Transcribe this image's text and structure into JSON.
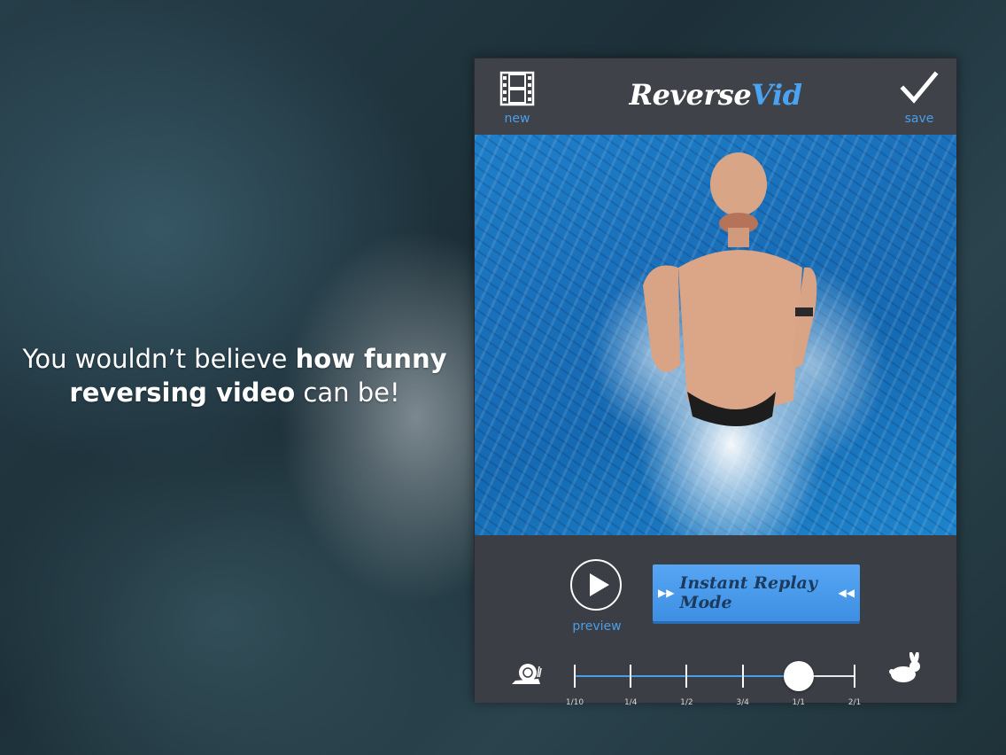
{
  "tagline": {
    "part1": "You wouldn’t believe ",
    "bold1": "how funny",
    "bold2": "reversing video",
    "part2": " can be!"
  },
  "header": {
    "new_label": "new",
    "logo_main": "Reverse",
    "logo_accent": "Vid",
    "save_label": "save"
  },
  "controls": {
    "preview_label": "preview",
    "replay_label": "Instant Replay Mode",
    "speed_ticks": [
      "1/10",
      "1/4",
      "1/2",
      "3/4",
      "1/1",
      "2/1"
    ],
    "selected_speed": "1/1"
  },
  "icons": {
    "new": "film-icon",
    "save": "checkmark-icon",
    "preview": "play-icon",
    "slow": "snail-icon",
    "fast": "rabbit-icon"
  },
  "colors": {
    "accent": "#4a9ee8",
    "panel": "#3b3e45",
    "button": "#4b9bee"
  }
}
